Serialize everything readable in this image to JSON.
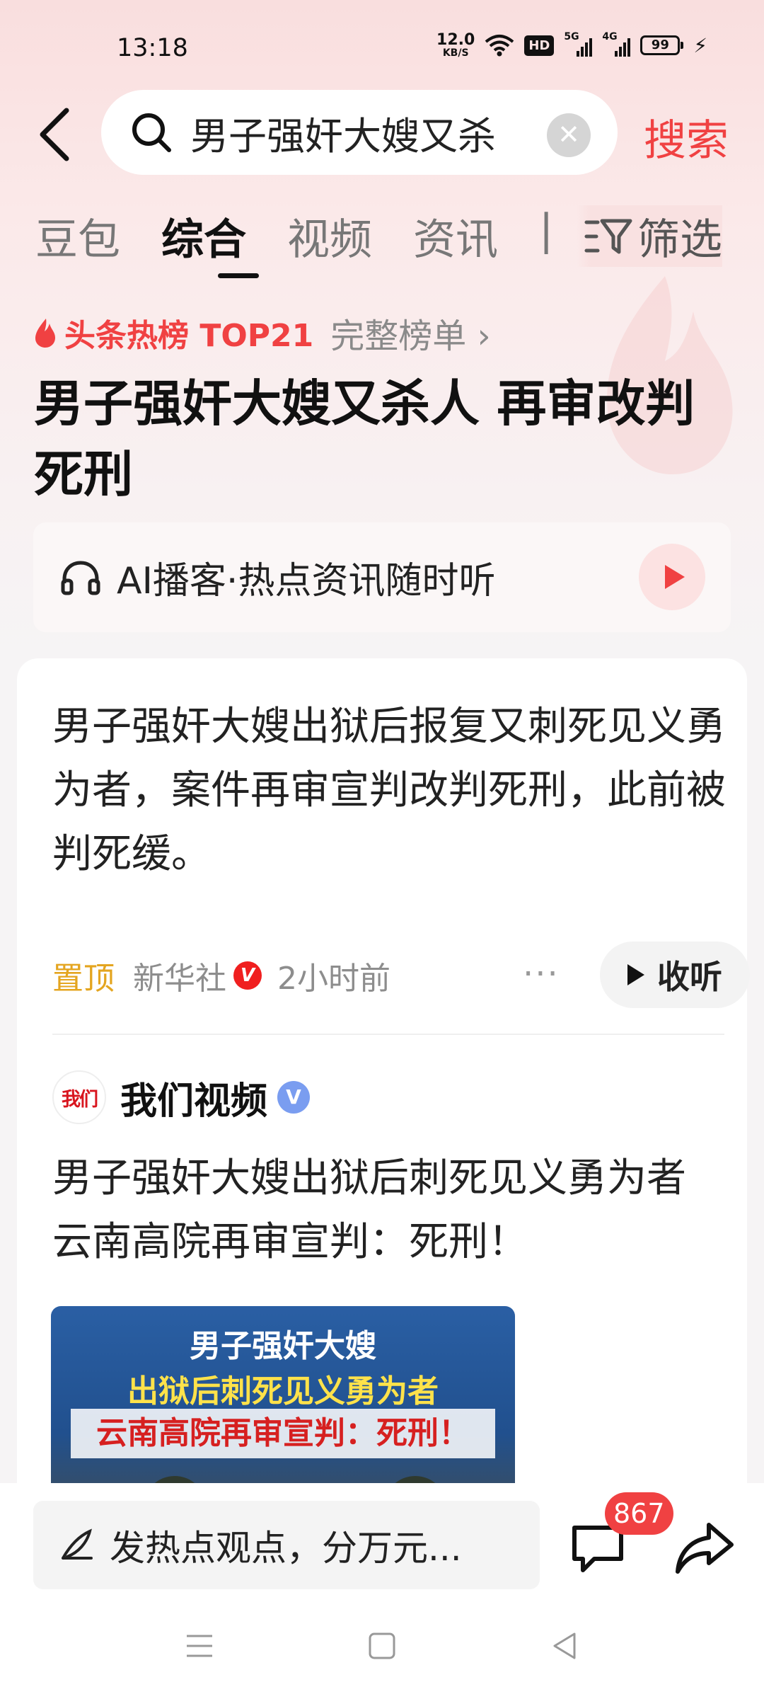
{
  "status_bar": {
    "time": "13:18",
    "net_speed_value": "12.0",
    "net_speed_unit": "KB/S",
    "hd_label": "HD",
    "sig1_label": "5G",
    "sig2_label": "4G",
    "battery": "99"
  },
  "search": {
    "query": "男子强奸大嫂又杀",
    "submit_label": "搜索"
  },
  "tabs": [
    {
      "label": "豆包",
      "active": false
    },
    {
      "label": "综合",
      "active": true
    },
    {
      "label": "视频",
      "active": false
    },
    {
      "label": "资讯",
      "active": false
    }
  ],
  "filter_label": "筛选",
  "hot": {
    "badge": "头条热榜 TOP21",
    "more": "完整榜单 ›",
    "title": "男子强奸大嫂又杀人 再审改判死刑"
  },
  "ai_podcast": {
    "text": "AI播客·热点资讯随时听"
  },
  "article1": {
    "text": "男子强奸大嫂出狱后报复又刺死见义勇为者，案件再审宣判改判死刑，此前被判死缓。",
    "pin_label": "置顶",
    "source": "新华社",
    "verified": "V",
    "time": "2小时前",
    "more": "···",
    "listen_label": "收听"
  },
  "article2": {
    "avatar_text": "我们",
    "author": "我们视频",
    "verified": "V",
    "text": "男子强奸大嫂出狱后刺死见义勇为者 云南高院再审宣判：死刑！",
    "thumb_line1": "男子强奸大嫂",
    "thumb_line2": "出狱后刺死见义勇为者",
    "thumb_line3": "云南高院再审宣判：死刑！"
  },
  "bottom": {
    "comment_placeholder": "发热点观点，分万元...",
    "comment_count": "867"
  },
  "colors": {
    "accent": "#f04142",
    "pin": "#e4a520",
    "verified_blue": "#7a9df0"
  }
}
